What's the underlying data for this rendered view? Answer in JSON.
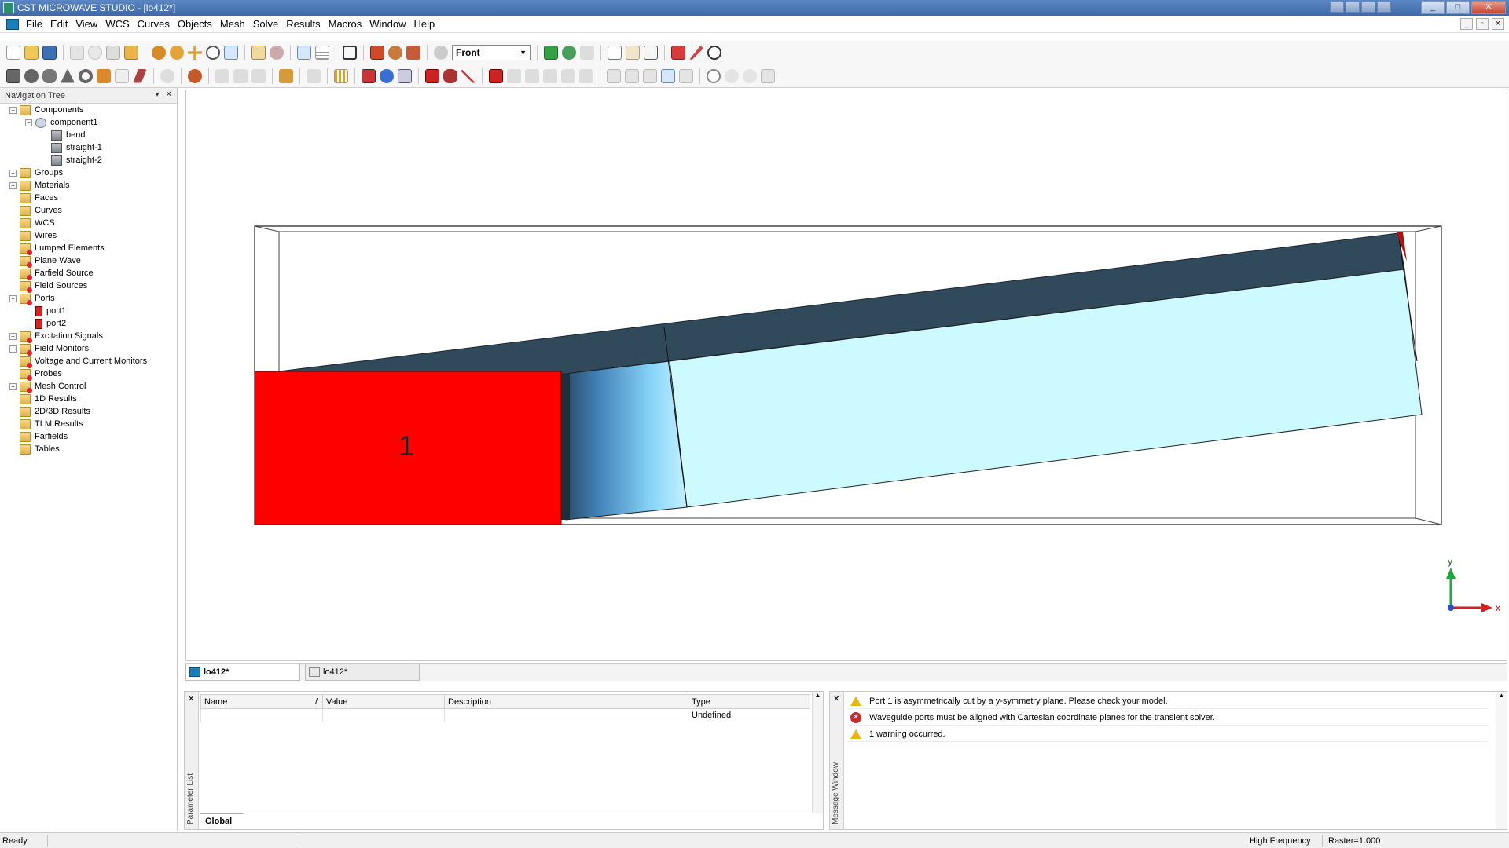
{
  "window": {
    "title": "CST MICROWAVE STUDIO - [lo412*]",
    "controls": [
      "_",
      "□",
      "✕"
    ],
    "mdi_controls": [
      "_",
      "▫",
      "✕"
    ]
  },
  "menu": {
    "items": [
      "File",
      "Edit",
      "View",
      "WCS",
      "Curves",
      "Objects",
      "Mesh",
      "Solve",
      "Results",
      "Macros",
      "Window",
      "Help"
    ]
  },
  "toolbar": {
    "view_selection": "Front"
  },
  "navigation_tree": {
    "header": "Navigation Tree",
    "header_controls": [
      "▾",
      "✕"
    ],
    "items": [
      {
        "label": "Components",
        "level": 0,
        "expander": "−",
        "icon": "folder"
      },
      {
        "label": "component1",
        "level": 1,
        "expander": "−",
        "icon": "component"
      },
      {
        "label": "bend",
        "level": 2,
        "expander": "",
        "icon": "solid"
      },
      {
        "label": "straight-1",
        "level": 2,
        "expander": "",
        "icon": "solid"
      },
      {
        "label": "straight-2",
        "level": 2,
        "expander": "",
        "icon": "solid"
      },
      {
        "label": "Groups",
        "level": 0,
        "expander": "+",
        "icon": "folder"
      },
      {
        "label": "Materials",
        "level": 0,
        "expander": "+",
        "icon": "folder"
      },
      {
        "label": "Faces",
        "level": 0,
        "expander": "",
        "icon": "folder"
      },
      {
        "label": "Curves",
        "level": 0,
        "expander": "",
        "icon": "folder"
      },
      {
        "label": "WCS",
        "level": 0,
        "expander": "",
        "icon": "folder"
      },
      {
        "label": "Wires",
        "level": 0,
        "expander": "",
        "icon": "folder"
      },
      {
        "label": "Lumped Elements",
        "level": 0,
        "expander": "",
        "icon": "folder-red"
      },
      {
        "label": "Plane Wave",
        "level": 0,
        "expander": "",
        "icon": "folder-red"
      },
      {
        "label": "Farfield Source",
        "level": 0,
        "expander": "",
        "icon": "folder-red"
      },
      {
        "label": "Field Sources",
        "level": 0,
        "expander": "",
        "icon": "folder-red"
      },
      {
        "label": "Ports",
        "level": 0,
        "expander": "−",
        "icon": "folder-red"
      },
      {
        "label": "port1",
        "level": 1,
        "expander": "",
        "icon": "port"
      },
      {
        "label": "port2",
        "level": 1,
        "expander": "",
        "icon": "port"
      },
      {
        "label": "Excitation Signals",
        "level": 0,
        "expander": "+",
        "icon": "folder-red"
      },
      {
        "label": "Field Monitors",
        "level": 0,
        "expander": "+",
        "icon": "folder-red"
      },
      {
        "label": "Voltage and Current Monitors",
        "level": 0,
        "expander": "",
        "icon": "folder-red"
      },
      {
        "label": "Probes",
        "level": 0,
        "expander": "",
        "icon": "folder-red"
      },
      {
        "label": "Mesh Control",
        "level": 0,
        "expander": "+",
        "icon": "folder-red"
      },
      {
        "label": "1D Results",
        "level": 0,
        "expander": "",
        "icon": "folder"
      },
      {
        "label": "2D/3D Results",
        "level": 0,
        "expander": "",
        "icon": "folder"
      },
      {
        "label": "TLM Results",
        "level": 0,
        "expander": "",
        "icon": "folder"
      },
      {
        "label": "Farfields",
        "level": 0,
        "expander": "",
        "icon": "folder"
      },
      {
        "label": "Tables",
        "level": 0,
        "expander": "",
        "icon": "folder"
      }
    ]
  },
  "viewport": {
    "port_label": "1",
    "axis_y_label": "y",
    "axis_x_label": "x",
    "colors": {
      "port_face": "#ff0000",
      "waveguide_light": "#ccfaff",
      "waveguide_dark": "#314a5b",
      "axis_y": "#1fa83a",
      "axis_x": "#d42020"
    }
  },
  "document_tabs": [
    {
      "label": "lo412*",
      "active": true
    },
    {
      "label": "lo412*",
      "active": false
    }
  ],
  "parameter_list": {
    "title": "Parameter List",
    "columns": [
      "Name",
      "/",
      "Value",
      "Description",
      "Type"
    ],
    "rows": [
      {
        "name": "",
        "value": "",
        "description": "",
        "type": "Undefined"
      }
    ],
    "sheet_tab": "Global"
  },
  "message_window": {
    "title": "Message Window",
    "messages": [
      {
        "level": "warning",
        "text": "Port 1 is asymmetrically cut by a y-symmetry plane. Please check your model."
      },
      {
        "level": "error",
        "text": "Waveguide ports must be aligned with Cartesian coordinate planes for the transient solver."
      },
      {
        "level": "warning",
        "text": "1 warning occurred."
      }
    ]
  },
  "statusbar": {
    "status": "Ready",
    "mode": "High Frequency",
    "raster": "Raster=1.000"
  }
}
